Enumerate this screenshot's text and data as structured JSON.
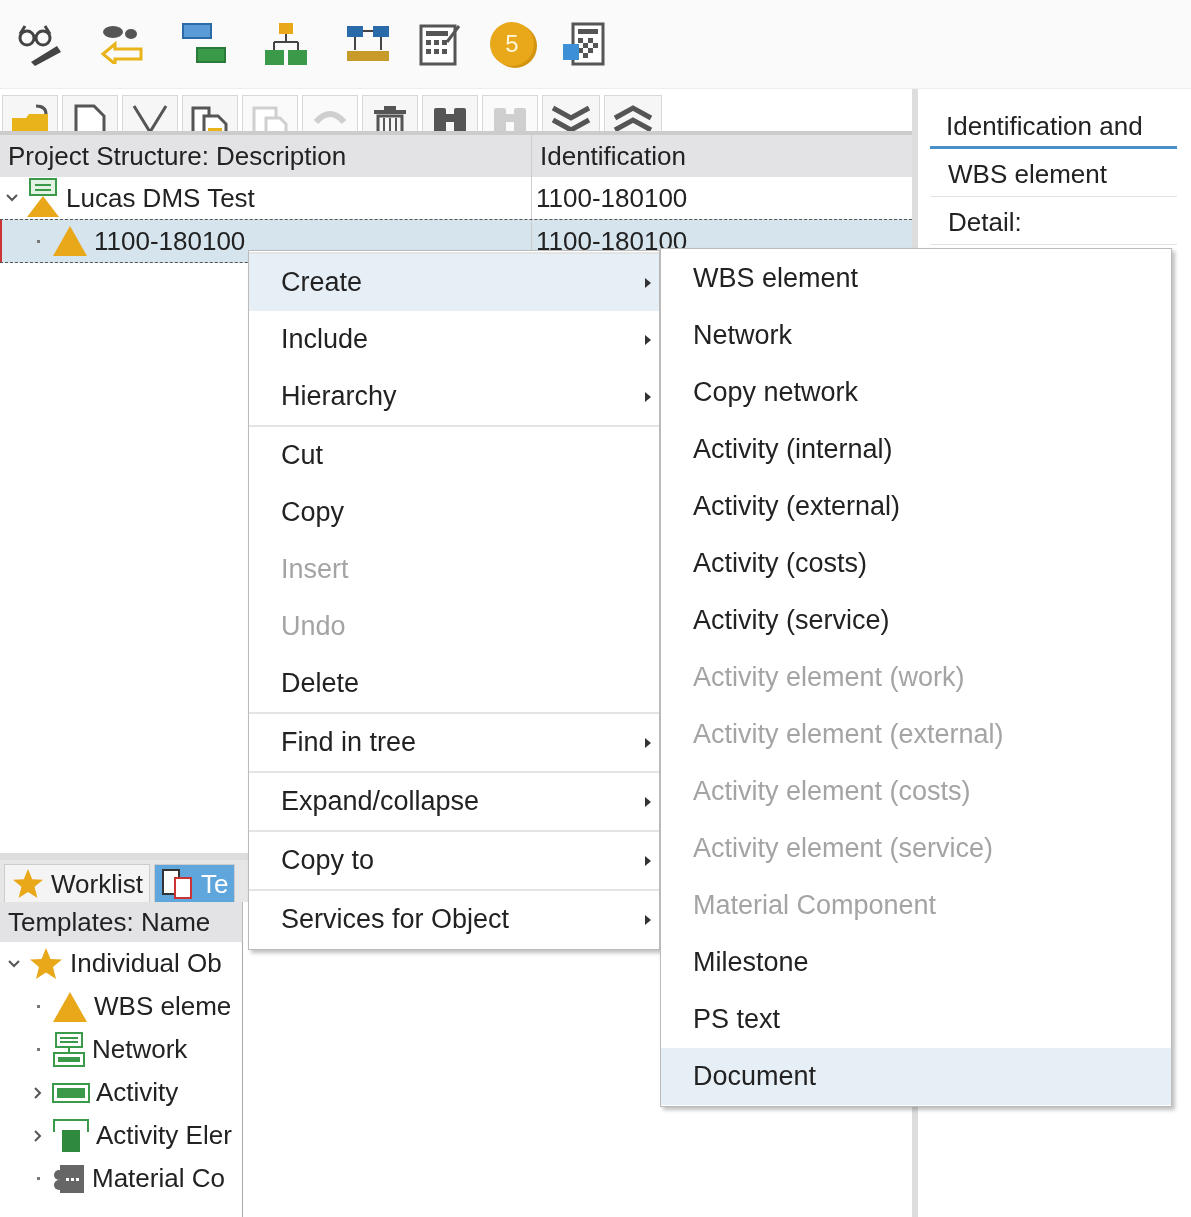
{
  "toolbar": {
    "coin_label": "5"
  },
  "edit_toolbar": [
    {
      "disabled": false
    },
    {
      "disabled": false
    },
    {
      "disabled": false
    },
    {
      "disabled": false
    },
    {
      "disabled": true
    },
    {
      "disabled": true
    },
    {
      "disabled": false
    },
    {
      "disabled": false
    },
    {
      "disabled": true
    },
    {
      "disabled": false
    },
    {
      "disabled": false
    }
  ],
  "project_tree": {
    "columns": [
      "Project Structure: Description",
      "Identification"
    ],
    "rows": [
      {
        "kind": "project",
        "description": "Lucas DMS Test",
        "identification": "1100-180100",
        "expanded": true,
        "selected": false,
        "children": [
          {
            "kind": "wbs",
            "description": "1100-180100",
            "identification": "1100-180100",
            "selected": true
          }
        ]
      }
    ]
  },
  "detail": {
    "tab": {
      "label": "Identification and",
      "selected": true
    },
    "fields": [
      "WBS element",
      "Detail:"
    ]
  },
  "templates": {
    "tabs": [
      {
        "label": "Worklist",
        "selected": false
      },
      {
        "label": "Te",
        "selected": true
      }
    ],
    "column": "Templates: Name",
    "rows": [
      {
        "kind": "folder",
        "label": "Individual Ob",
        "expanded": true,
        "children": [
          {
            "kind": "wbs",
            "label": "WBS eleme",
            "expandable": false
          },
          {
            "kind": "network",
            "label": "Network",
            "expandable": false
          },
          {
            "kind": "activity",
            "label": "Activity",
            "expandable": true
          },
          {
            "kind": "activity_element",
            "label": "Activity Eler",
            "expandable": true
          },
          {
            "kind": "material",
            "label": "Material Co",
            "expandable": false
          }
        ]
      }
    ]
  },
  "context_menu": {
    "groups": [
      [
        {
          "label": "Create",
          "submenu": true,
          "disabled": false,
          "selected": true
        },
        {
          "label": "Include",
          "submenu": true,
          "disabled": false,
          "selected": false
        },
        {
          "label": "Hierarchy",
          "submenu": true,
          "disabled": false,
          "selected": false
        }
      ],
      [
        {
          "label": "Cut",
          "submenu": false,
          "disabled": false,
          "selected": false
        },
        {
          "label": "Copy",
          "submenu": false,
          "disabled": false,
          "selected": false
        },
        {
          "label": "Insert",
          "submenu": false,
          "disabled": true,
          "selected": false
        },
        {
          "label": "Undo",
          "submenu": false,
          "disabled": true,
          "selected": false
        },
        {
          "label": "Delete",
          "submenu": false,
          "disabled": false,
          "selected": false
        }
      ],
      [
        {
          "label": "Find in tree",
          "submenu": true,
          "disabled": false,
          "selected": false
        }
      ],
      [
        {
          "label": "Expand/collapse",
          "submenu": true,
          "disabled": false,
          "selected": false
        }
      ],
      [
        {
          "label": "Copy to",
          "submenu": true,
          "disabled": false,
          "selected": false
        }
      ],
      [
        {
          "label": "Services for Object",
          "submenu": true,
          "disabled": false,
          "selected": false
        }
      ]
    ]
  },
  "create_submenu": [
    {
      "label": "WBS element",
      "disabled": false,
      "selected": false
    },
    {
      "label": "Network",
      "disabled": false,
      "selected": false
    },
    {
      "label": "Copy network",
      "disabled": false,
      "selected": false
    },
    {
      "label": "Activity (internal)",
      "disabled": false,
      "selected": false
    },
    {
      "label": "Activity (external)",
      "disabled": false,
      "selected": false
    },
    {
      "label": "Activity (costs)",
      "disabled": false,
      "selected": false
    },
    {
      "label": "Activity (service)",
      "disabled": false,
      "selected": false
    },
    {
      "label": "Activity element (work)",
      "disabled": true,
      "selected": false
    },
    {
      "label": "Activity element (external)",
      "disabled": true,
      "selected": false
    },
    {
      "label": "Activity element (costs)",
      "disabled": true,
      "selected": false
    },
    {
      "label": "Activity element (service)",
      "disabled": true,
      "selected": false
    },
    {
      "label": "Material Component",
      "disabled": true,
      "selected": false
    },
    {
      "label": "Milestone",
      "disabled": false,
      "selected": false
    },
    {
      "label": "PS text",
      "disabled": false,
      "selected": false
    },
    {
      "label": "Document",
      "disabled": false,
      "selected": true
    }
  ]
}
